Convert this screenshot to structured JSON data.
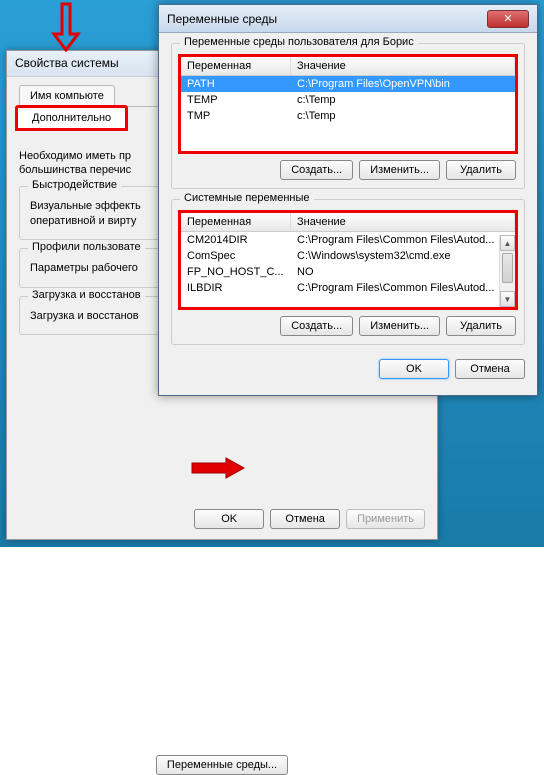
{
  "sysprops": {
    "title": "Свойства системы",
    "tab_computer_name": "Имя компьюте",
    "tab_advanced": "Дополнительно",
    "note": "Необходимо иметь пр\nбольшинства перечис",
    "group_perf_title": "Быстродействие",
    "group_perf_text": "Визуальные эффекть\nоперативной и вирту",
    "group_prof_title": "Профили пользовате",
    "group_prof_text": "Параметры рабочего",
    "group_boot_title": "Загрузка и восстанов",
    "group_boot_text": "Загрузка и восстанов",
    "env_button": "Переменные среды...",
    "ok": "OK",
    "cancel": "Отмена",
    "apply": "Применить"
  },
  "envdlg": {
    "title": "Переменные среды",
    "user_section_title": "Переменные среды пользователя для Борис",
    "sys_section_title": "Системные переменные",
    "col_name": "Переменная",
    "col_value": "Значение",
    "user_vars": [
      {
        "name": "PATH",
        "value": "C:\\Program Files\\OpenVPN\\bin",
        "selected": true
      },
      {
        "name": "TEMP",
        "value": "c:\\Temp",
        "selected": false
      },
      {
        "name": "TMP",
        "value": "c:\\Temp",
        "selected": false
      }
    ],
    "sys_vars": [
      {
        "name": "CM2014DIR",
        "value": "C:\\Program Files\\Common Files\\Autod..."
      },
      {
        "name": "ComSpec",
        "value": "C:\\Windows\\system32\\cmd.exe"
      },
      {
        "name": "FP_NO_HOST_C...",
        "value": "NO"
      },
      {
        "name": "ILBDIR",
        "value": "C:\\Program Files\\Common Files\\Autod..."
      }
    ],
    "btn_new": "Создать...",
    "btn_edit": "Изменить...",
    "btn_delete": "Удалить",
    "ok": "OK",
    "cancel": "Отмена"
  }
}
